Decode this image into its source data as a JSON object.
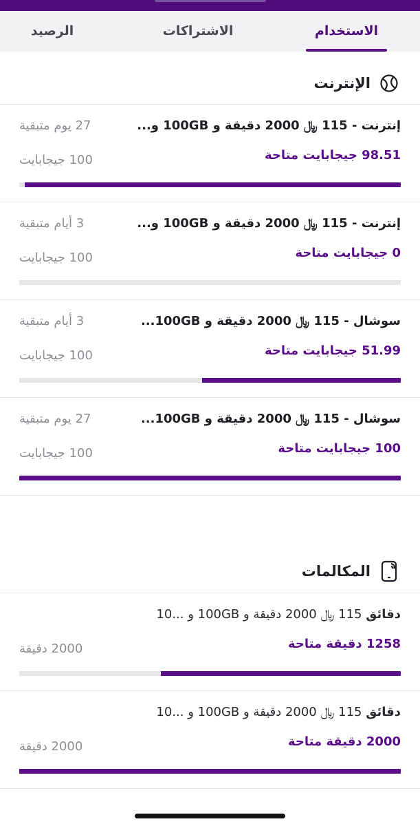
{
  "tabs": [
    {
      "label": "الاستخدام",
      "active": true
    },
    {
      "label": "الاشتراكات",
      "active": false
    },
    {
      "label": "الرصيد",
      "active": false
    }
  ],
  "internet": {
    "title": "الإنترنت",
    "icon": "globe-icon",
    "items": [
      {
        "name": "إنترنت - 115 ﷼ 2000 دقيقة و 100GB و...",
        "remaining": "27 يوم متبقية",
        "available": "98.51 جيجابايت متاحة",
        "total": "100 جيجابايت",
        "fraction": 0.9851
      },
      {
        "name": "إنترنت - 115 ﷼ 2000 دقيقة و 100GB و...",
        "remaining": "3 أيام متبقية",
        "available": "0 جيجابايت متاحة",
        "total": "100 جيجابايت",
        "fraction": 0
      },
      {
        "name": "سوشال - 115 ﷼ 2000 دقيقة و 100GB...",
        "remaining": "3 أيام متبقية",
        "available": "51.99 جيجابايت متاحة",
        "total": "100 جيجابايت",
        "fraction": 0.5199
      },
      {
        "name": "سوشال - 115 ﷼ 2000 دقيقة و 100GB...",
        "remaining": "27 يوم متبقية",
        "available": "100 جيجابايت متاحة",
        "total": "100 جيجابايت",
        "fraction": 1
      }
    ]
  },
  "calls": {
    "title": "المكالمات",
    "icon": "phone-icon",
    "items": [
      {
        "name_bold": "دقائق",
        "name": "115 ﷼ 2000 دقيقة و 100GB و ...10",
        "available": "1258 دقيقة متاحة",
        "total": "2000 دقيقة",
        "fraction": 0.629
      },
      {
        "name_bold": "دقائق",
        "name": "115 ﷼ 2000 دقيقة و 100GB و ...10",
        "available": "2000 دقيقة متاحة",
        "total": "2000 دقيقة",
        "fraction": 1
      }
    ]
  },
  "colors": {
    "accent": "#5c0f8b",
    "topbar": "#4f0c7a",
    "muted": "#8e8e96"
  }
}
